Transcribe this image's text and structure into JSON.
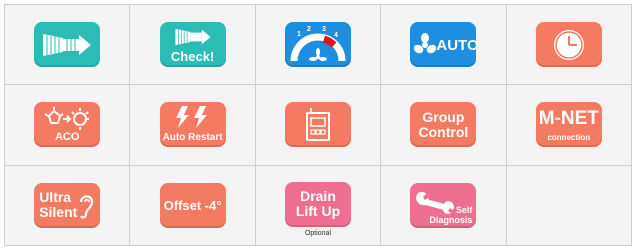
{
  "colors": {
    "teal": "#2cbcb6",
    "blue": "#1e8fe0",
    "salmon": "#f47a62",
    "pink": "#ee6f90",
    "red_marker": "#e0151b"
  },
  "tiles": {
    "airflow": {
      "icon": "airflow-arrow-icon"
    },
    "check": {
      "label": "Check!",
      "icon": "airflow-arrow-icon"
    },
    "fan_speed": {
      "steps": [
        "1",
        "2",
        "3",
        "4"
      ],
      "active_step": "3",
      "icon": "fan-speed-gauge-icon"
    },
    "fan_auto": {
      "label": "AUTO",
      "icon": "fan-icon"
    },
    "timer": {
      "icon": "clock-icon"
    },
    "aco": {
      "label": "ACO",
      "icon": "aco-sun-icon"
    },
    "auto_restart": {
      "label": "Auto Restart",
      "icon": "lightning-icon"
    },
    "remote": {
      "icon": "remote-controller-icon"
    },
    "group_control": {
      "line1": "Group",
      "line2": "Control"
    },
    "mnet": {
      "title": "M-NET",
      "sub": "connection"
    },
    "ultra_silent": {
      "line1": "Ultra",
      "line2": "Silent",
      "icon": "ear-icon"
    },
    "offset": {
      "label": "Offset -4°"
    },
    "drain": {
      "line1": "Drain",
      "line2": "Lift Up",
      "note": "Optional"
    },
    "self_diagnosis": {
      "line1": "Self",
      "line2": "Diagnosis",
      "icon": "wrench-icon"
    }
  }
}
